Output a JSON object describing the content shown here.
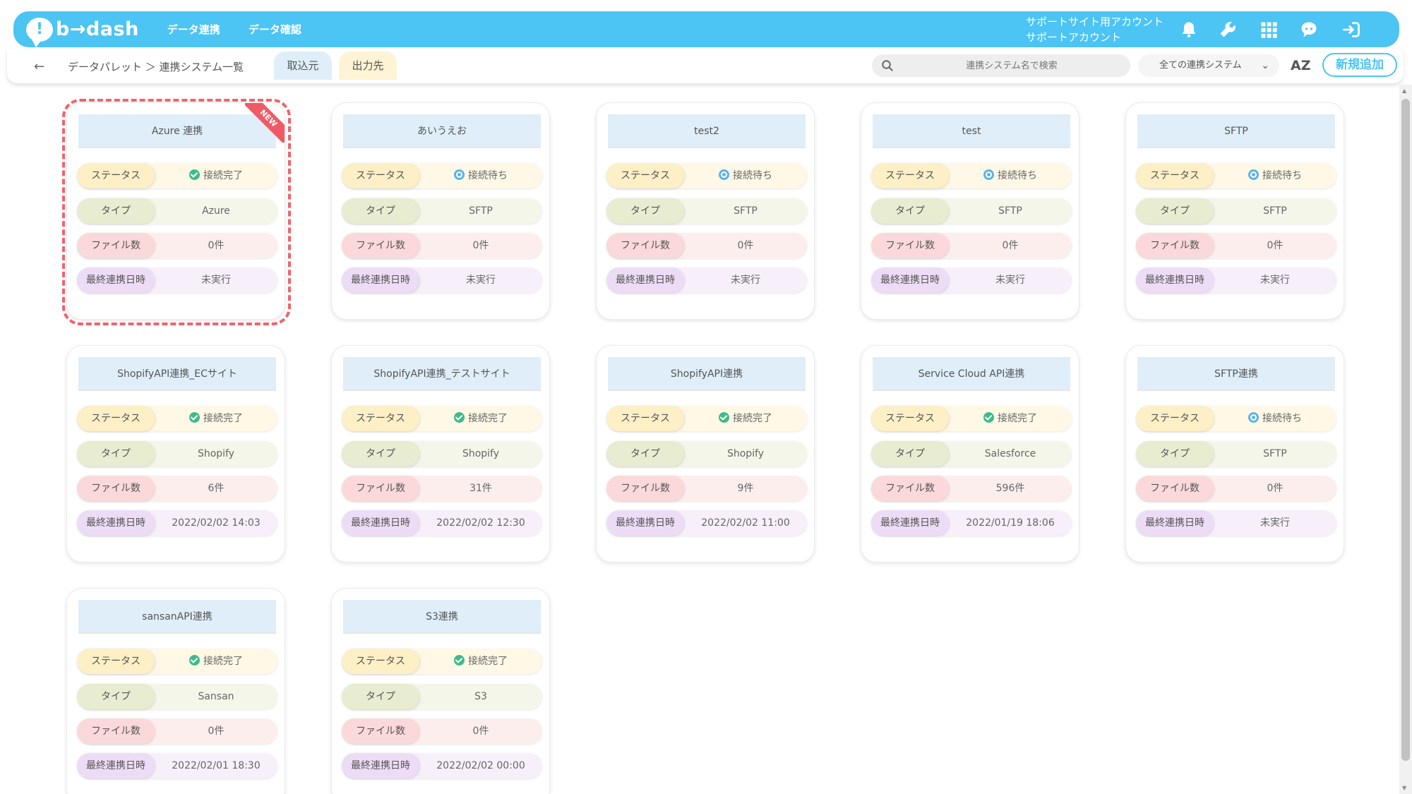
{
  "header": {
    "logo_text": "b→dash",
    "logo_mark": "!",
    "nav": [
      "データ連携",
      "データ確認"
    ],
    "account_line1": "サポートサイト用アカウント",
    "account_line2": "サポートアカウント",
    "icons": [
      "bell-icon",
      "wrench-icon",
      "grid-icon",
      "assistant-icon",
      "logout-icon"
    ],
    "bar_color": "#4cc4f4"
  },
  "subbar": {
    "breadcrumb": "データパレット ＞ 連携システム一覧",
    "tab_import": "取込元",
    "tab_export": "出力先",
    "search_placeholder": "連携システム名で検索",
    "filter_value": "全ての連携システム",
    "sort_label": "AZ",
    "new_button": "新規追加"
  },
  "labels": {
    "status": "ステータス",
    "type": "タイプ",
    "files": "ファイル数",
    "last_run": "最終連携日時",
    "new_badge": "NEW"
  },
  "cards": [
    {
      "title": "Azure 連携",
      "status": "接続完了",
      "status_kind": "done",
      "type": "Azure",
      "files": "0件",
      "last_run": "未実行",
      "is_new": true
    },
    {
      "title": "あいうえお",
      "status": "接続待ち",
      "status_kind": "wait",
      "type": "SFTP",
      "files": "0件",
      "last_run": "未実行"
    },
    {
      "title": "test2",
      "status": "接続待ち",
      "status_kind": "wait",
      "type": "SFTP",
      "files": "0件",
      "last_run": "未実行"
    },
    {
      "title": "test",
      "status": "接続待ち",
      "status_kind": "wait",
      "type": "SFTP",
      "files": "0件",
      "last_run": "未実行"
    },
    {
      "title": "SFTP",
      "status": "接続待ち",
      "status_kind": "wait",
      "type": "SFTP",
      "files": "0件",
      "last_run": "未実行"
    },
    {
      "title": "ShopifyAPI連携_ECサイト",
      "status": "接続完了",
      "status_kind": "done",
      "type": "Shopify",
      "files": "6件",
      "last_run": "2022/02/02 14:03"
    },
    {
      "title": "ShopifyAPI連携_テストサイト",
      "status": "接続完了",
      "status_kind": "done",
      "type": "Shopify",
      "files": "31件",
      "last_run": "2022/02/02 12:30"
    },
    {
      "title": "ShopifyAPI連携",
      "status": "接続完了",
      "status_kind": "done",
      "type": "Shopify",
      "files": "9件",
      "last_run": "2022/02/02 11:00"
    },
    {
      "title": "Service Cloud API連携",
      "status": "接続完了",
      "status_kind": "done",
      "type": "Salesforce",
      "files": "596件",
      "last_run": "2022/01/19 18:06"
    },
    {
      "title": "SFTP連携",
      "status": "接続待ち",
      "status_kind": "wait",
      "type": "SFTP",
      "files": "0件",
      "last_run": "未実行"
    },
    {
      "title": "sansanAPI連携",
      "status": "接続完了",
      "status_kind": "done",
      "type": "Sansan",
      "files": "0件",
      "last_run": "2022/02/01 18:30"
    },
    {
      "title": "S3連携",
      "status": "接続完了",
      "status_kind": "done",
      "type": "S3",
      "files": "0件",
      "last_run": "2022/02/02 00:00"
    }
  ]
}
